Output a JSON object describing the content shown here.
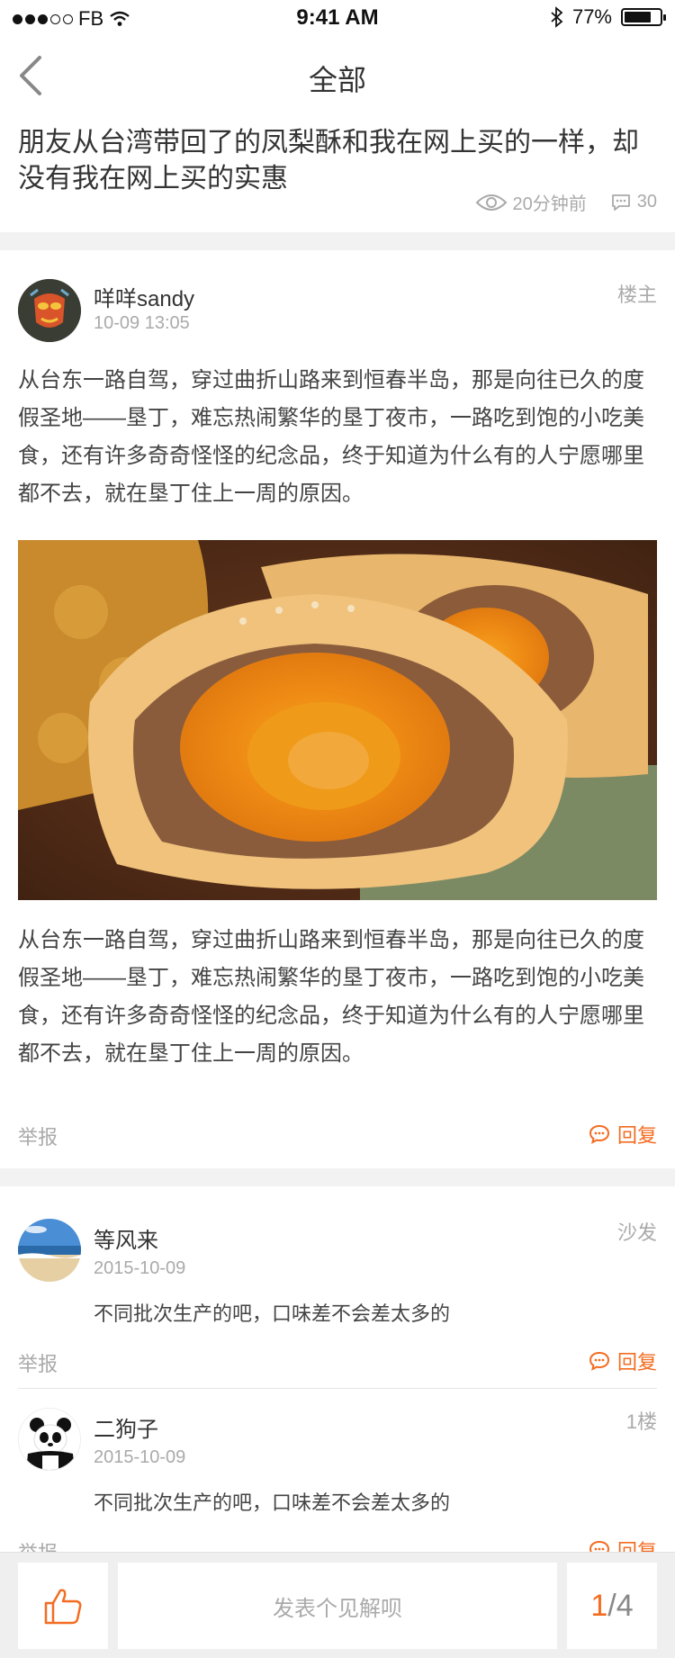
{
  "status_bar": {
    "carrier": "FB",
    "time": "9:41 AM",
    "battery": "77%",
    "battery_level": 0.77
  },
  "nav": {
    "title": "全部"
  },
  "post": {
    "title": "朋友从台湾带回了的凤梨酥和我在网上买的一样，却没有我在网上买的实惠",
    "views": "20分钟前",
    "comment_count": "30"
  },
  "floor_main": {
    "username": "咩咩sandy",
    "date": "10-09  13:05",
    "floor": "楼主",
    "paragraph_1": "从台东一路自驾，穿过曲折山路来到恒春半岛，那是向往已久的度假圣地——垦丁，难忘热闹繁华的垦丁夜市，一路吃到饱的小吃美食，还有许多奇奇怪怪的纪念品，终于知道为什么有的人宁愿哪里都不去，就在垦丁住上一周的原因。",
    "paragraph_2": "从台东一路自驾，穿过曲折山路来到恒春半岛，那是向往已久的度假圣地——垦丁，难忘热闹繁华的垦丁夜市，一路吃到饱的小吃美食，还有许多奇奇怪怪的纪念品，终于知道为什么有的人宁愿哪里都不去，就在垦丁住上一周的原因。",
    "report": "举报",
    "reply": "回复"
  },
  "comments": [
    {
      "username": "等风来",
      "date": "2015-10-09",
      "floor": "沙发",
      "text": "不同批次生产的吧，口味差不会差太多的",
      "report": "举报",
      "reply": "回复"
    },
    {
      "username": "二狗子",
      "date": "2015-10-09",
      "floor": "1楼",
      "text": "不同批次生产的吧，口味差不会差太多的",
      "report": "举报",
      "reply": "回复"
    }
  ],
  "bottom_bar": {
    "placeholder": "发表个见解呗",
    "page_current": "1",
    "page_sep": "/",
    "page_total": "4"
  },
  "colors": {
    "accent": "#f36c21",
    "muted": "#aaaaaa",
    "text": "#333333"
  }
}
